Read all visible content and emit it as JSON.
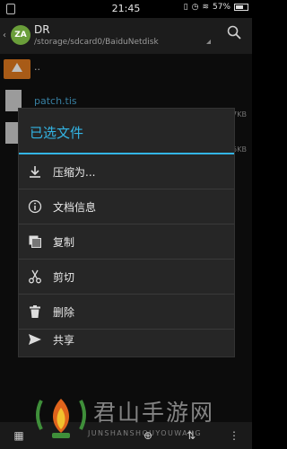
{
  "status_bar": {
    "time": "21:45",
    "battery": "57%"
  },
  "action_bar": {
    "title": "DR",
    "path": "/storage/sdcard0/BaiduNetdisk",
    "logo_text": "ZA"
  },
  "file_list": [
    {
      "name": "..",
      "type": "parent-folder",
      "size": ""
    },
    {
      "name": "patch.tis",
      "type": "file",
      "size": "7KB"
    },
    {
      "name": "",
      "type": "file",
      "size": "5KB"
    }
  ],
  "dialog": {
    "title": "已选文件",
    "items": [
      {
        "label": "压缩为...",
        "icon": "download-icon"
      },
      {
        "label": "文档信息",
        "icon": "info-icon"
      },
      {
        "label": "复制",
        "icon": "copy-icon"
      },
      {
        "label": "剪切",
        "icon": "scissors-icon"
      },
      {
        "label": "删除",
        "icon": "trash-icon"
      },
      {
        "label": "共享",
        "icon": "send-icon"
      }
    ]
  },
  "watermark": {
    "title": "君山手游网",
    "subtitle": "JUNSHANSHOUYOUWANG"
  },
  "colors": {
    "accent": "#33b5e5",
    "folder": "#e07a1f",
    "dialog_bg": "#262626"
  }
}
